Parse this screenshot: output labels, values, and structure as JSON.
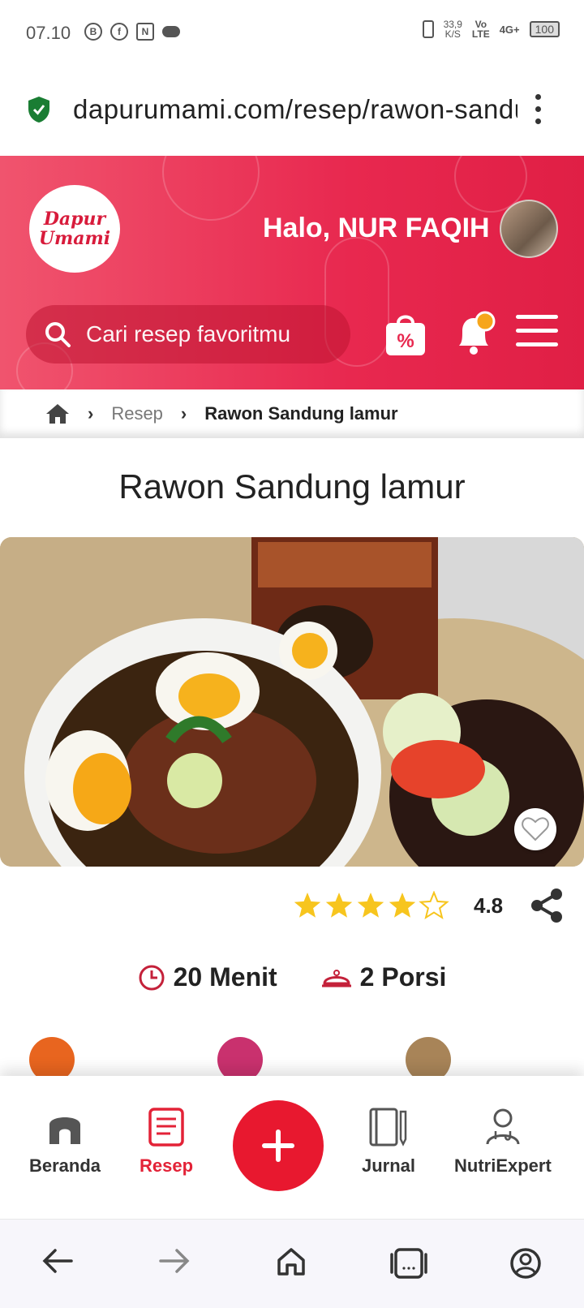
{
  "status": {
    "time": "07.10",
    "speed_value": "33,9",
    "speed_unit": "K/S",
    "volte_top": "Vo",
    "volte_bottom": "LTE",
    "network": "4G+",
    "battery": "100"
  },
  "browser": {
    "url": "dapurumami.com/resep/rawon-sandung-lamur"
  },
  "header": {
    "logo_line1": "Dapur",
    "logo_line2": "Umami",
    "greeting": "Halo, NUR FAQIH",
    "search_placeholder": "Cari resep favoritmu",
    "promo_symbol": "%"
  },
  "breadcrumb": {
    "items": [
      "Resep",
      "Rawon Sandung lamur"
    ]
  },
  "recipe": {
    "title": "Rawon Sandung lamur",
    "rating": "4.8",
    "rating_value": 4.8,
    "rating_max": 5,
    "time": "20 Menit",
    "portion": "2 Porsi"
  },
  "bottom_nav": {
    "items": [
      {
        "label": "Beranda"
      },
      {
        "label": "Resep"
      },
      {
        "label": "Jurnal"
      },
      {
        "label": "NutriExpert"
      }
    ]
  },
  "colors": {
    "brand_red": "#e32237",
    "star": "#f7c51e"
  }
}
